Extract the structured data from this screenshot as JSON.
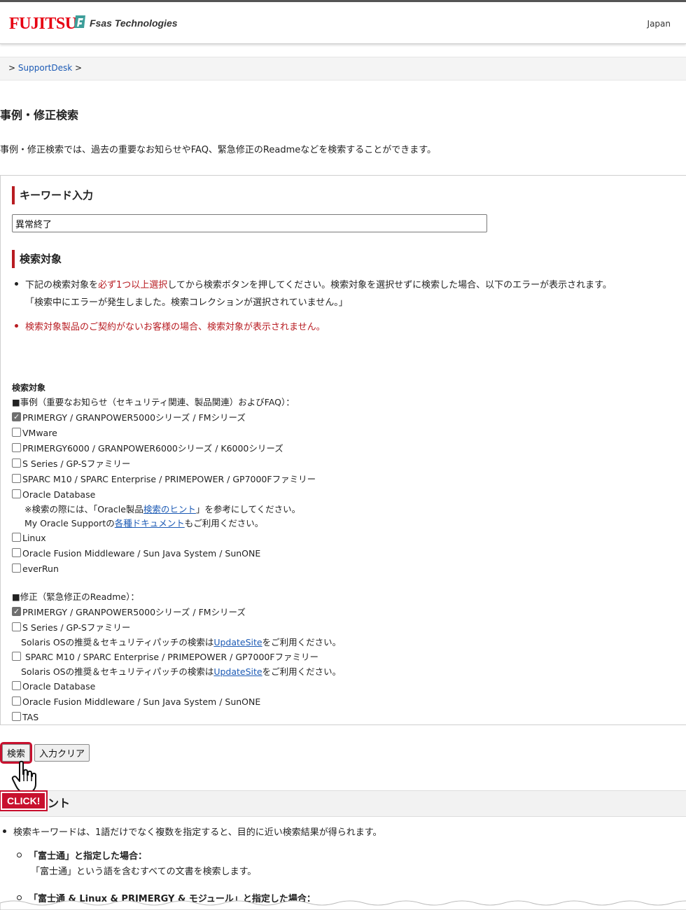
{
  "header": {
    "brand_left": "FUJITSU",
    "brand_right": "Fsas Technologies",
    "region": "Japan"
  },
  "breadcrumb": {
    "prefix": ">",
    "link": "SupportDesk",
    "suffix": ">"
  },
  "page": {
    "title": "事例・修正検索",
    "intro": "事例・修正検索では、過去の重要なお知らせやFAQ、緊急修正のReadmeなどを検索することができます。"
  },
  "keyword": {
    "heading": "キーワード入力",
    "value": "異常終了"
  },
  "target": {
    "heading": "検索対象",
    "bullet1_a": "下記の検索対象を",
    "bullet1_red": "必ず1つ以上選択",
    "bullet1_b": "してから検索ボタンを押してください。検索対象を選択せずに検索した場合、以下のエラーが表示されます。",
    "bullet1_line2": "「検索中にエラーが発生しました。検索コレクションが選択されていません。」",
    "bullet2": "検索対象製品のご契約がないお客様の場合、検索対象が表示されません。"
  },
  "list": {
    "label": "検索対象",
    "cases_header": "■事例（重要なお知らせ（セキュリティ関連、製品関連）およびFAQ）：",
    "cases": [
      {
        "label": "PRIMERGY / GRANPOWER5000シリーズ / FMシリーズ",
        "checked": true
      },
      {
        "label": "VMware",
        "checked": false
      },
      {
        "label": "PRIMERGY6000 / GRANPOWER6000シリーズ / K6000シリーズ",
        "checked": false
      },
      {
        "label": "S Series / GP-Sファミリー",
        "checked": false
      },
      {
        "label": "SPARC M10 / SPARC Enterprise / PRIMEPOWER / GP7000Fファミリー",
        "checked": false
      },
      {
        "label": "Oracle Database",
        "checked": false
      },
      {
        "label": "Linux",
        "checked": false
      },
      {
        "label": "Oracle Fusion Middleware / Sun Java System / SunONE",
        "checked": false
      },
      {
        "label": "everRun",
        "checked": false
      }
    ],
    "oracle_note1_a": "※検索の際には、「Oracle製品",
    "oracle_note1_link": "検索のヒント",
    "oracle_note1_b": "」を参考にしてください。",
    "oracle_note2_a": "My Oracle Supportの",
    "oracle_note2_link": "各種ドキュメント",
    "oracle_note2_b": "もご利用ください。",
    "fixes_header": "■修正（緊急修正のReadme）：",
    "fixes": [
      {
        "label": "PRIMERGY / GRANPOWER5000シリーズ / FMシリーズ",
        "checked": true
      },
      {
        "label": "S Series / GP-Sファミリー",
        "checked": false
      },
      {
        "label": " SPARC M10 / SPARC Enterprise / PRIMEPOWER / GP7000Fファミリー",
        "checked": false
      },
      {
        "label": "Oracle Database",
        "checked": false
      },
      {
        "label": "Oracle Fusion Middleware / Sun Java System / SunONE",
        "checked": false
      },
      {
        "label": "TAS",
        "checked": false
      }
    ],
    "solaris_note_a": "Solaris OSの推奨＆セキュリティパッチの検索は",
    "solaris_note_link": "UpdateSite",
    "solaris_note_b": "をご利用ください。"
  },
  "buttons": {
    "search": "検索",
    "clear": "入力クリア"
  },
  "annotation": {
    "click": "CLICK!"
  },
  "hints": {
    "heading_visible": "ント",
    "item1": "検索キーワードは、1語だけでなく複数を指定すると、目的に近い検索結果が得られます。",
    "ex1_title": "「富士通」と指定した場合：",
    "ex1_text": "「富士通」という語を含むすべての文書を検索します。",
    "ex2_title": "「富士通 & Linux & PRIMERGY & モジュール」と指定した場合："
  },
  "colors": {
    "accent": "#b81c22",
    "link": "#1d5bb5",
    "brand": "#e60012",
    "click": "#c8102e"
  }
}
